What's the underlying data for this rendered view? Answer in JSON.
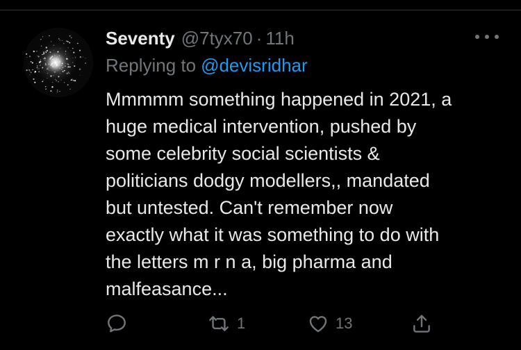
{
  "author": {
    "name": "Seventy",
    "handle": "@7tyx70",
    "separator": "·",
    "time": "11h"
  },
  "reply": {
    "prefix": "Replying to",
    "mention": "@devisridhar"
  },
  "body_lines": [
    "Mmmmm something happened in 2021, a",
    "huge medical intervention, pushed by",
    "some celebrity social scientists &",
    "politicians  dodgy modellers,, mandated",
    "but untested. Can't remember now",
    "exactly what it was  something to do with",
    "the letters m r n a, big pharma and",
    "malfeasance..."
  ],
  "actions": {
    "reply_count": "",
    "retweet_count": "1",
    "like_count": "13"
  },
  "icons": {
    "more": "more-horizontal-icon",
    "reply": "reply-bubble-icon",
    "retweet": "retweet-icon",
    "like": "heart-icon",
    "share": "share-upload-icon"
  },
  "colors": {
    "background": "#000000",
    "text_primary": "#e7e9ea",
    "text_secondary": "#71767b",
    "accent": "#1d9bf0",
    "divider": "#2f3336"
  }
}
